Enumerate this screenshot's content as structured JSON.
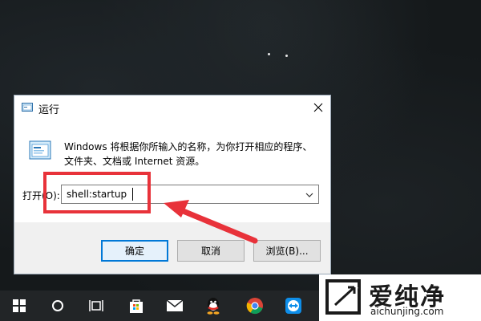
{
  "dialog": {
    "title": "运行",
    "description_line1": "Windows 将根据你所输入的名称，为你打开相应的程序、",
    "description_line2": "文件夹、文档或 Internet 资源。",
    "open_label": "打开(O):",
    "open_value": "shell:startup",
    "ok_label": "确定",
    "cancel_label": "取消",
    "browse_label": "浏览(B)..."
  },
  "taskbar": {
    "icons": [
      "windows-start-icon",
      "search-circle-icon",
      "task-view-icon",
      "store-icon",
      "mail-icon",
      "qq-icon",
      "chrome-icon",
      "teamviewer-icon"
    ]
  },
  "watermark": {
    "brand_cn": "爱纯净",
    "url": "aichunjing.com"
  },
  "colors": {
    "highlight": "#e8323a",
    "primary_button_border": "#0078d7",
    "taskbar": "#222527"
  }
}
